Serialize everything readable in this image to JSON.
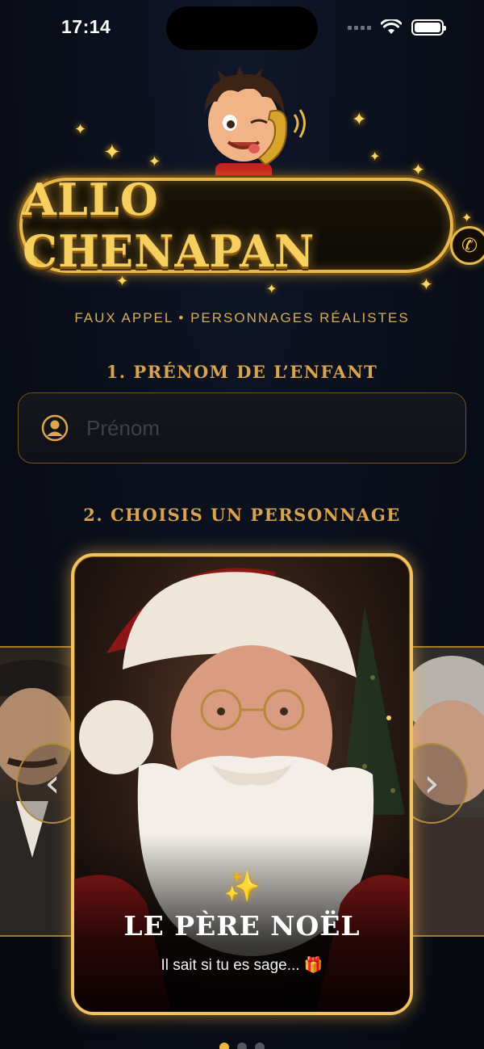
{
  "status_bar": {
    "time": "17:14"
  },
  "logo": {
    "title": "ALLO CHENAPAN"
  },
  "tagline": "FAUX APPEL • PERSONNAGES RÉALISTES",
  "step1": {
    "title": "1. PRÉNOM DE L’ENFANT",
    "placeholder": "Prénom",
    "value": ""
  },
  "step2": {
    "title": "2. CHOISIS UN PERSONNAGE"
  },
  "carousel": {
    "current": {
      "name": "LE PÈRE NOËL",
      "subtitle": "Il sait si tu es sage... 🎁",
      "sparkle": "✨"
    },
    "prev_icon": "chevron-left-icon",
    "next_icon": "chevron-right-icon",
    "page_count": 3,
    "active_page": 0
  },
  "colors": {
    "gold": "#f2c160",
    "accent_text": "#d9a44c",
    "background": "#0a0f1c"
  }
}
